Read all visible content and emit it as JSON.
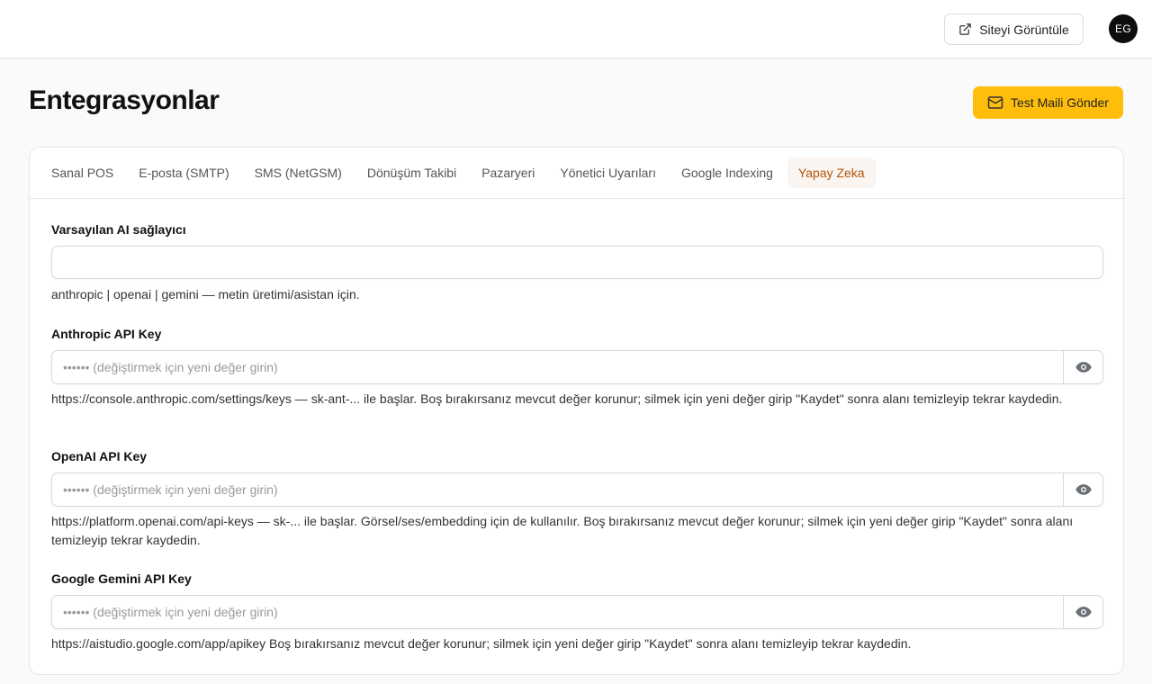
{
  "header": {
    "view_site_label": "Siteyi Görüntüle",
    "avatar_initials": "EG"
  },
  "page": {
    "title": "Entegrasyonlar",
    "test_mail_label": "Test Maili Gönder"
  },
  "tabs": [
    {
      "label": "Sanal POS",
      "active": false
    },
    {
      "label": "E-posta (SMTP)",
      "active": false
    },
    {
      "label": "SMS (NetGSM)",
      "active": false
    },
    {
      "label": "Dönüşüm Takibi",
      "active": false
    },
    {
      "label": "Pazaryeri",
      "active": false
    },
    {
      "label": "Yönetici Uyarıları",
      "active": false
    },
    {
      "label": "Google Indexing",
      "active": false
    },
    {
      "label": "Yapay Zeka",
      "active": true
    }
  ],
  "form": {
    "provider": {
      "label": "Varsayılan AI sağlayıcı",
      "value": "",
      "help": "anthropic | openai | gemini — metin üretimi/asistan için."
    },
    "anthropic": {
      "label": "Anthropic API Key",
      "placeholder": "•••••• (değiştirmek için yeni değer girin)",
      "help": "https://console.anthropic.com/settings/keys — sk-ant-... ile başlar. Boş bırakırsanız mevcut değer korunur; silmek için yeni değer girip \"Kaydet\" sonra alanı temizleyip tekrar kaydedin."
    },
    "openai": {
      "label": "OpenAI API Key",
      "placeholder": "•••••• (değiştirmek için yeni değer girin)",
      "help": "https://platform.openai.com/api-keys — sk-... ile başlar. Görsel/ses/embedding için de kullanılır. Boş bırakırsanız mevcut değer korunur; silmek için yeni değer girip \"Kaydet\" sonra alanı temizleyip tekrar kaydedin."
    },
    "gemini": {
      "label": "Google Gemini API Key",
      "placeholder": "•••••• (değiştirmek için yeni değer girin)",
      "help": "https://aistudio.google.com/app/apikey Boş bırakırsanız mevcut değer korunur; silmek için yeni değer girip \"Kaydet\" sonra alanı temizleyip tekrar kaydedin."
    }
  },
  "colors": {
    "accent": "#ffbe0b",
    "active_tab_text": "#b5540b",
    "active_tab_bg": "#faf5f0"
  }
}
